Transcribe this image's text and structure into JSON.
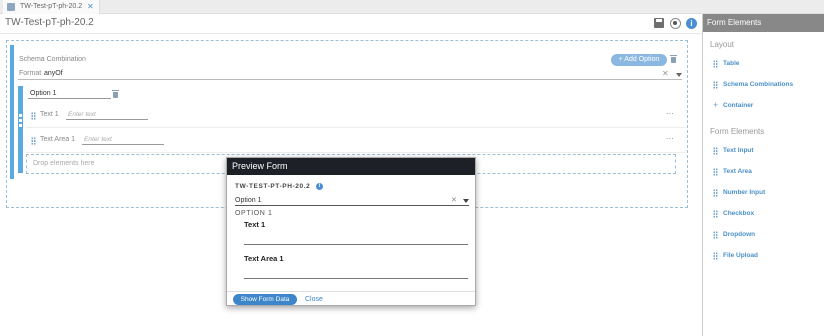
{
  "tab": {
    "label": "TW-Test-pT-ph-20.2",
    "close": "✕"
  },
  "header": {
    "title": "TW-Test-pT-ph-20.2",
    "info": "i"
  },
  "editor": {
    "schema_label": "Schema Combination",
    "add_option": "+ Add Option",
    "format_label": "Format",
    "format_value": "anyOf",
    "format_clear": "✕",
    "option_value": "Option 1",
    "fields": [
      {
        "label": "Text 1",
        "placeholder": "Enter text"
      },
      {
        "label": "Text Area 1",
        "placeholder": "Enter text"
      }
    ],
    "more": "...",
    "drop_zone": "Drop elements here"
  },
  "sidebar": {
    "title": "Form Elements",
    "layout_heading": "Layout",
    "layout_items": [
      "Table",
      "Schema Combinations",
      "Container"
    ],
    "elements_heading": "Form Elements",
    "element_items": [
      "Text Input",
      "Text Area",
      "Number Input",
      "Checkbox",
      "Dropdown",
      "File Upload"
    ]
  },
  "preview": {
    "title": "Preview Form",
    "form_title": "TW-TEST-PT-PH-20.2",
    "info": "i",
    "selected_option": "Option 1",
    "clear": "✕",
    "option_heading": "OPTION 1",
    "field1_label": "Text 1",
    "field2_label": "Text Area 1",
    "show_data": "Show Form Data",
    "close": "Close"
  }
}
